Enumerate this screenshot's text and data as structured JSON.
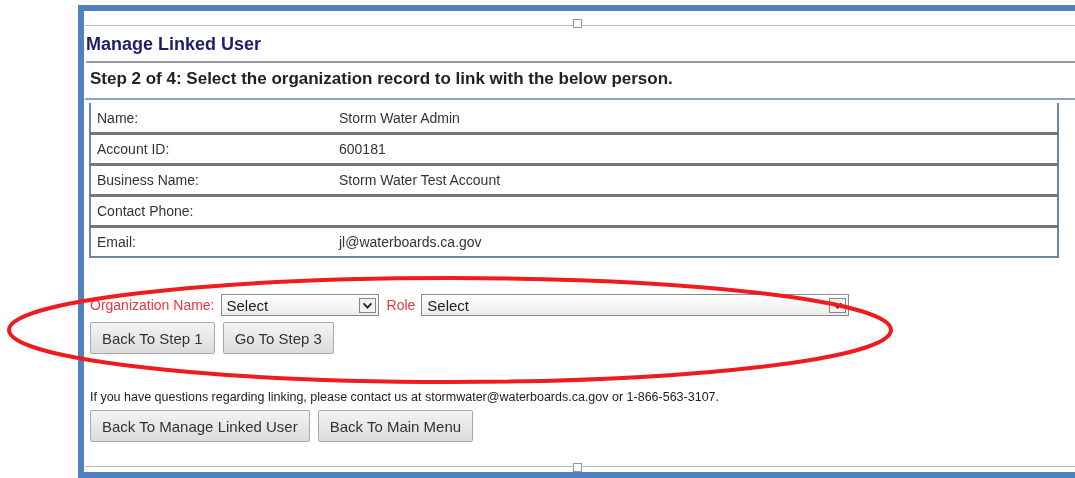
{
  "heading": "Manage Linked User",
  "step": "Step 2 of 4: Select the organization record to link with the below person.",
  "details": [
    {
      "label": "Name:",
      "value": "Storm Water Admin"
    },
    {
      "label": "Account ID:",
      "value": "600181"
    },
    {
      "label": "Business Name:",
      "value": "Storm Water Test Account"
    },
    {
      "label": "Contact Phone:"
    },
    {
      "label": "Email:",
      "value": "jl@waterboards.ca.gov"
    }
  ],
  "selects": [
    {
      "label": "Organization Name:",
      "value": "Select"
    },
    {
      "label": "Role",
      "value": "Select"
    }
  ],
  "step_buttons": [
    "Back To Step 1",
    "Go To Step 3"
  ],
  "help_text": "If you have questions regarding linking, please contact us at stormwater@waterboards.ca.gov or 1-866-563-3107.",
  "nav_buttons": [
    "Back To Manage Linked User",
    "Back To Main Menu"
  ]
}
